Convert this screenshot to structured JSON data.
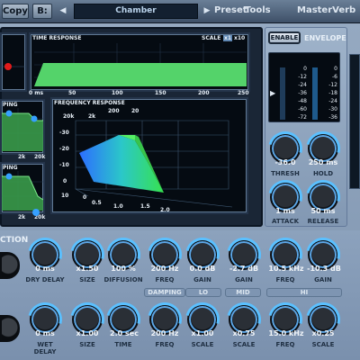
{
  "toolbar": {
    "copy_label": "Copy",
    "b_label": "B:",
    "preset_name": "Chamber",
    "preset_label": "Preset",
    "tools_label": "Tools",
    "product_name": "MasterVerb",
    "left_arrow": "◀",
    "right_arrow": "▶"
  },
  "time_response": {
    "title": "TIME RESPONSE",
    "scale_label": "SCALE",
    "scale_x1": "x1",
    "scale_x10": "x10",
    "x_ticks": [
      "0 ms",
      "50",
      "100",
      "150",
      "200",
      "250"
    ]
  },
  "left_small": {
    "title_top": "PING",
    "title_bottom": "PING",
    "x_labels_top": [
      "2k",
      "20k"
    ],
    "x_labels_bottom": [
      "2k",
      "20k"
    ]
  },
  "frequency_response": {
    "title": "FREQUENCY RESPONSE",
    "x_ticks": [
      "20k",
      "2k",
      "200",
      "20"
    ],
    "y_ticks": [
      "-30",
      "-20",
      "-10",
      "0",
      "10"
    ],
    "z_ticks": [
      "0",
      "0.5",
      "1.0",
      "1.5",
      "2.0"
    ]
  },
  "envelope": {
    "enable_label": "ENABLE",
    "title": "ENVELOPE",
    "left_scale": [
      "0",
      "-12",
      "-24",
      "-36",
      "-48",
      "-60",
      "-72"
    ],
    "right_scale": [
      "0",
      "-6",
      "-12",
      "-18",
      "-24",
      "-30",
      "-36"
    ],
    "thresh": {
      "value": "-36.0",
      "label": "THRESH"
    },
    "hold": {
      "value": "250 ms",
      "label": "HOLD"
    },
    "attack": {
      "value": "1 ms",
      "label": "ATTACK"
    },
    "release": {
      "value": "50 ms",
      "label": "RELEASE"
    }
  },
  "row1": {
    "section_label": "CTION",
    "knobs": [
      {
        "value": "0 ms",
        "label": "DRY DELAY"
      },
      {
        "value": "x1.50",
        "label": "SIZE"
      },
      {
        "value": "100 %",
        "label": "DIFFUSION"
      },
      {
        "value": "200 Hz",
        "label": "FREQ"
      },
      {
        "value": "0.0 dB",
        "label": "GAIN"
      },
      {
        "value": "-2.7 dB",
        "label": "GAIN"
      },
      {
        "value": "10.5 kHz",
        "label": "FREQ"
      },
      {
        "value": "-10.3 dB",
        "label": "GAIN"
      }
    ]
  },
  "bands": {
    "damping": "DAMPING",
    "lo": "LO",
    "mid": "MID",
    "hi": "HI"
  },
  "row2": {
    "knobs": [
      {
        "value": "0 ms",
        "label": "WET DELAY"
      },
      {
        "value": "x1.00",
        "label": "SIZE"
      },
      {
        "value": "2.0 sec",
        "label": "TIME"
      },
      {
        "value": "200 Hz",
        "label": "FREQ"
      },
      {
        "value": "x1.00",
        "label": "SCALE"
      },
      {
        "value": "x0.75",
        "label": "SCALE"
      },
      {
        "value": "15.0 kHz",
        "label": "FREQ"
      },
      {
        "value": "x0.25",
        "label": "SCALE"
      }
    ]
  },
  "colors": {
    "accent": "#5ac0ff",
    "green": "#54d36a",
    "bg": "#8aa0bb"
  }
}
